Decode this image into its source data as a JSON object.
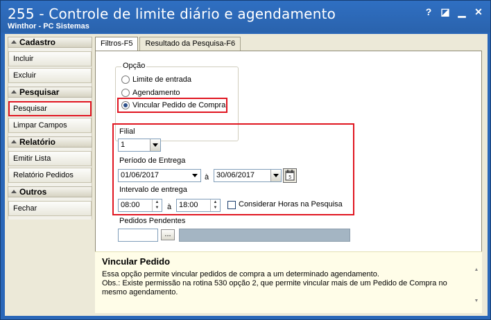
{
  "window": {
    "title": "255 - Controle de limite diário e agendamento",
    "subtitle": "Winthor - PC Sistemas",
    "buttons": {
      "help": "?",
      "restore": "◪",
      "minimize": "▁",
      "close": "✕"
    }
  },
  "sidebar": {
    "groups": [
      {
        "title": "Cadastro",
        "items": [
          "Incluir",
          "Excluir"
        ]
      },
      {
        "title": "Pesquisar",
        "items": [
          "Pesquisar",
          "Limpar Campos"
        ]
      },
      {
        "title": "Relatório",
        "items": [
          "Emitir Lista",
          "Relatório Pedidos"
        ]
      },
      {
        "title": "Outros",
        "items": [
          "Fechar"
        ]
      }
    ]
  },
  "tabs": [
    "Filtros-F5",
    "Resultado da Pesquisa-F6"
  ],
  "opcao": {
    "title": "Opção",
    "options": [
      "Limite de entrada",
      "Agendamento",
      "Vincular Pedido de Compra"
    ],
    "selected": "Vincular Pedido de Compra"
  },
  "filters": {
    "filial_label": "Filial",
    "filial_value": "1",
    "periodo_label": "Período de Entrega",
    "periodo_inicio": "01/06/2017",
    "periodo_sep": "à",
    "periodo_fim": "30/06/2017",
    "intervalo_label": "Intervalo de entrega",
    "hora_inicio": "08:00",
    "hora_sep": "à",
    "hora_fim": "18:00",
    "considerar_horas": "Considerar Horas na Pesquisa",
    "pedidos_pendentes_label": "Pedidos Pendentes",
    "ellipsis": "..."
  },
  "info": {
    "title": "Vincular Pedido",
    "line1": "Essa opção permite vincular pedidos de compra a um determinado agendamento.",
    "line2": "Obs.: Existe permissão na rotina 530 opção 2, que permite vincular mais de um Pedido de Compra no mesmo agendamento."
  },
  "colors": {
    "title_bar": "#2a67b8",
    "highlight": "#e0141f",
    "info_bg": "#fffde8"
  }
}
